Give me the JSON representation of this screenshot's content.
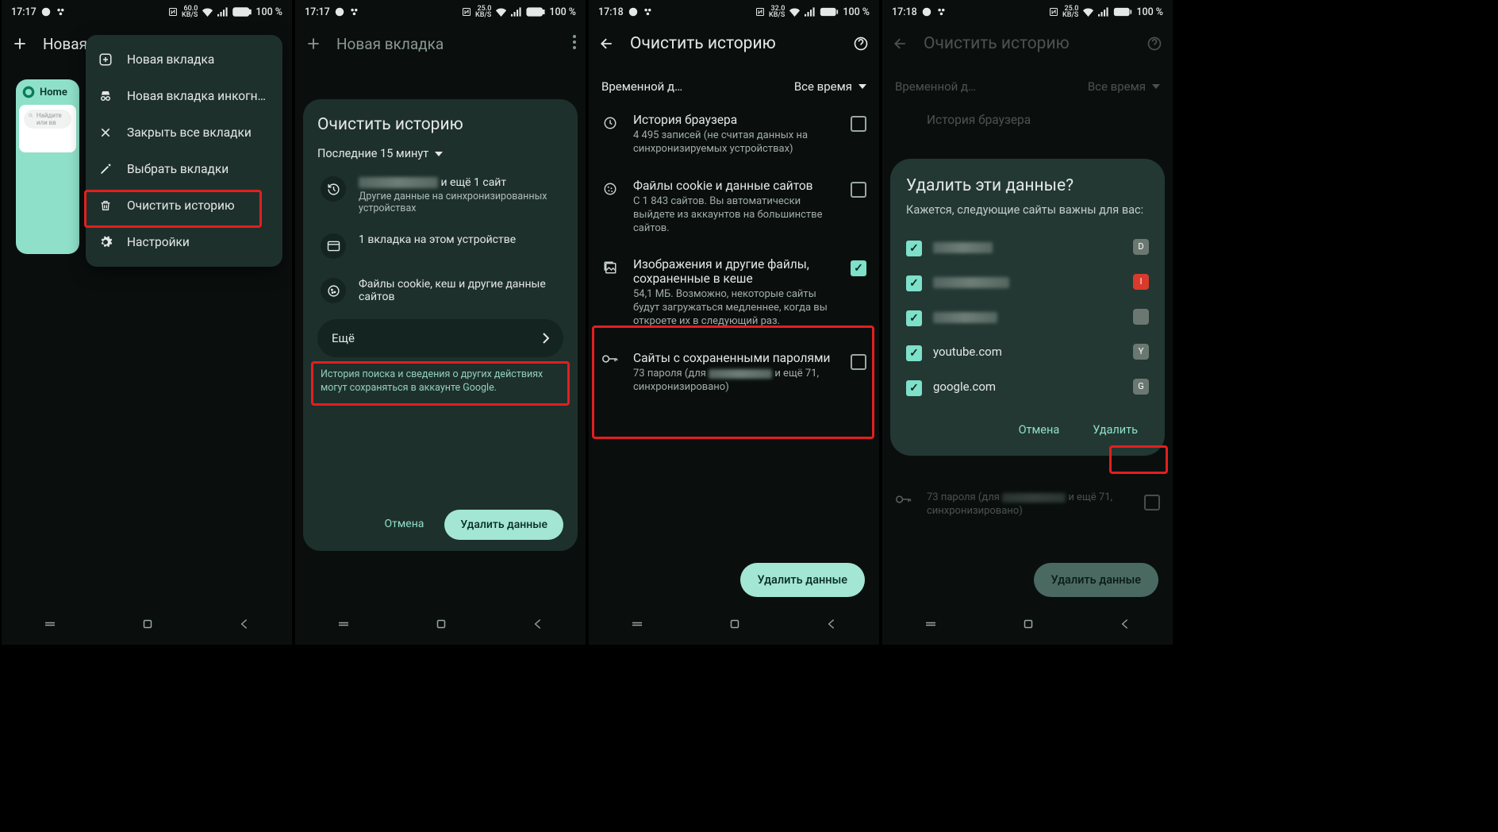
{
  "status": {
    "p1": {
      "time": "17:17",
      "kbs": "60.0",
      "battery": "100 %"
    },
    "p2": {
      "time": "17:17",
      "kbs": "25.0",
      "battery": "100 %"
    },
    "p3": {
      "time": "17:18",
      "kbs": "32.0",
      "battery": "100 %"
    },
    "p4": {
      "time": "17:18",
      "kbs": "25.0",
      "battery": "100 %"
    },
    "kbs_unit": "KB/S"
  },
  "p1": {
    "toolbar_new": "Новая",
    "tab_name": "Home",
    "tab_url_hint": "Найдите или вв",
    "menu": {
      "new_tab": "Новая вкладка",
      "incognito": "Новая вкладка инкогн…",
      "close_all": "Закрыть все вкладки",
      "select": "Выбрать вкладки",
      "clear": "Очистить историю",
      "settings": "Настройки"
    }
  },
  "p2": {
    "toolbar_new": "Новая вкладка",
    "sheet_title": "Очистить историю",
    "time_chip": "Последние 15 минут",
    "row1_suffix": "и ещё 1 сайт",
    "row1_sub": "Другие данные на синхронизированных устройствах",
    "row2": "1 вкладка на этом устройстве",
    "row3": "Файлы cookie, кеш и другие данные сайтов",
    "more": "Ещё",
    "footer": "История поиска и сведения о других действиях могут сохраняться в аккаунте Google.",
    "cancel": "Отмена",
    "delete": "Удалить данные"
  },
  "p3": {
    "title": "Очистить историю",
    "range_label": "Временной д…",
    "range_value": "Все время",
    "items": {
      "history": {
        "title": "История браузера",
        "desc": "4 495 записей (не считая данных на синхронизируемых устройствах)",
        "checked": false
      },
      "cookies": {
        "title": "Файлы cookie и данные сайтов",
        "desc": "С 1 843 сайтов. Вы автоматически выйдете из аккаунтов на большинстве сайтов.",
        "checked": false
      },
      "cache": {
        "title": "Изображения и другие файлы, сохраненные в кеше",
        "desc": "54,1 МБ. Возможно, некоторые сайты будут загружаться медленнее, когда вы откроете их в следующий раз.",
        "checked": true
      },
      "passwords": {
        "title": "Сайты с сохраненными паролями",
        "desc_prefix": "73 пароля (для",
        "desc_suffix": "и ещё 71, синхронизировано)",
        "checked": false
      }
    },
    "delete": "Удалить данные"
  },
  "p4": {
    "title": "Очистить историю",
    "range_label": "Временной д…",
    "range_value": "Все время",
    "bg_history_title": "История браузера",
    "bg_pass_desc_prefix": "73 пароля (для",
    "bg_pass_desc_suffix": "и ещё 71, синхронизировано)",
    "dialog": {
      "title": "Удалить эти данные?",
      "sub": "Кажется, следующие сайты важны для вас:",
      "sites": [
        {
          "label": "",
          "blurred": true,
          "fav": "D",
          "fav_bg": "#6b7871"
        },
        {
          "label": "",
          "blurred": true,
          "fav": "I",
          "fav_bg": "#d93a2c"
        },
        {
          "label": "",
          "blurred": true,
          "fav": "",
          "fav_bg": "#6b7871"
        },
        {
          "label": "youtube.com",
          "blurred": false,
          "fav": "Y",
          "fav_bg": "#6b7871"
        },
        {
          "label": "google.com",
          "blurred": false,
          "fav": "G",
          "fav_bg": "#6b7871"
        }
      ],
      "cancel": "Отмена",
      "delete": "Удалить"
    },
    "delete": "Удалить данные"
  }
}
